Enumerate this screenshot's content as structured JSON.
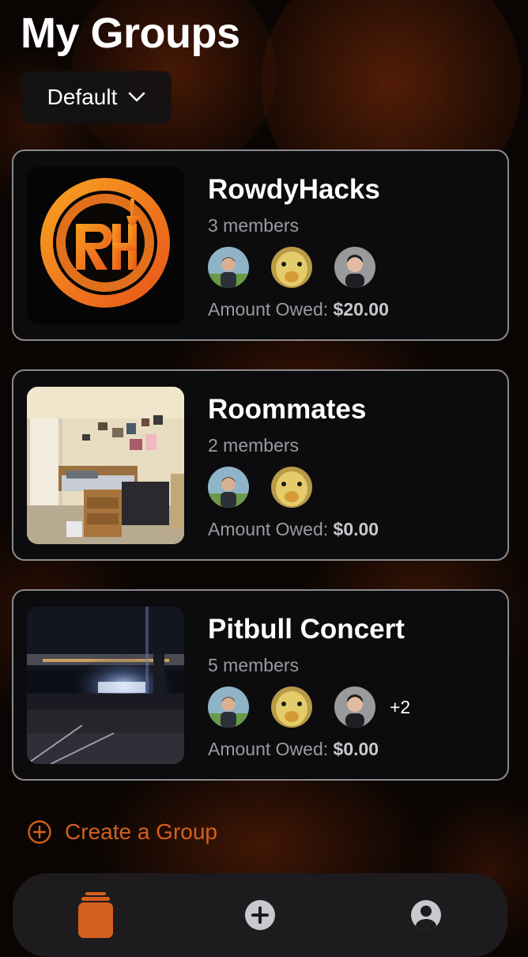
{
  "header": {
    "title": "My Groups",
    "sort_label": "Default"
  },
  "groups": [
    {
      "name": "RowdyHacks",
      "members_label": "3 members",
      "owed_label": "Amount Owed:",
      "owed_amount": "$20.00",
      "extra_members": ""
    },
    {
      "name": "Roommates",
      "members_label": "2 members",
      "owed_label": "Amount Owed:",
      "owed_amount": "$0.00",
      "extra_members": ""
    },
    {
      "name": "Pitbull Concert",
      "members_label": "5 members",
      "owed_label": "Amount Owed:",
      "owed_amount": "$0.00",
      "extra_members": "+2"
    }
  ],
  "actions": {
    "create_group_label": "Create a Group"
  },
  "tab_bar": {
    "items": [
      "groups-icon",
      "add-icon",
      "profile-icon"
    ]
  },
  "colors": {
    "accent": "#d4601d",
    "card_bg": "#0c0b0d",
    "card_border": "#8a8a8e",
    "tab_bar_bg": "#1d1b1e"
  }
}
